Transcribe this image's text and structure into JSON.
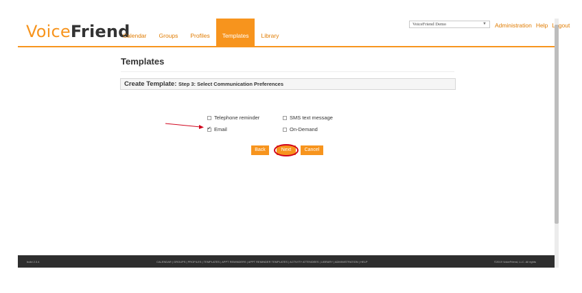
{
  "header": {
    "logo_voice": "Voice",
    "logo_friend": "Friend",
    "nav": [
      "Calendar",
      "Groups",
      "Profiles",
      "Templates",
      "Library"
    ],
    "active_nav": "Templates",
    "account_select": "VoiceFriend Demo",
    "top_links": [
      "Administration",
      "Help",
      "Logout"
    ]
  },
  "main": {
    "page_title": "Templates",
    "step_title": "Create Template:",
    "step_detail": "Step 3: Select Communication Preferences",
    "options": {
      "telephone": {
        "label": "Telephone reminder",
        "checked": false
      },
      "sms": {
        "label": "SMS text message",
        "checked": false
      },
      "email": {
        "label": "Email",
        "checked": true
      },
      "on_demand": {
        "label": "On-Demand",
        "checked": false
      }
    },
    "buttons": {
      "back": "Back",
      "next": "Next",
      "cancel": "Cancel"
    }
  },
  "footer": {
    "build": "build 2.3.4",
    "links": "CALENDAR | GROUPS | PROFILES | TEMPLATES | APPT REMINDERS | APPT REMINDER TEMPLATES | ACTIVITY ATTENDEES | LIBRARY | ADMINISTRATION | HELP",
    "copyright": "©2019 VoiceFriend, LLC. All rights"
  },
  "colors": {
    "accent": "#f7941d",
    "annotation": "#d0021b",
    "footer_bg": "#2e2e2e"
  }
}
